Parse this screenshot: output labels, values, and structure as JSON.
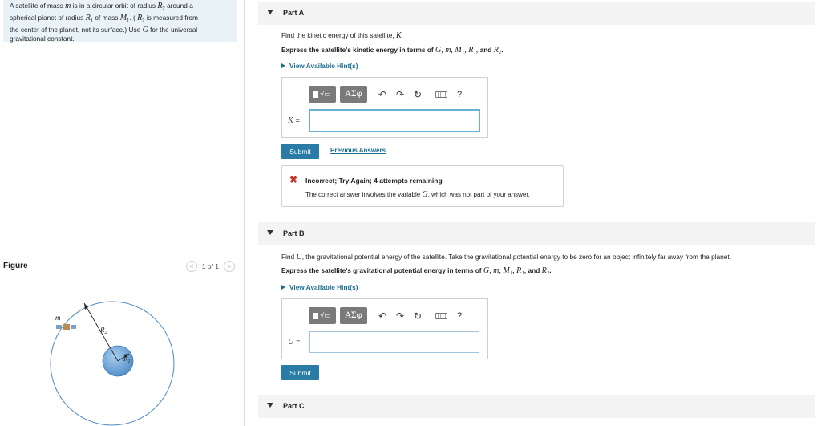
{
  "problem": {
    "line1_a": "A satellite of mass ",
    "line1_m": "m",
    "line1_b": " is in a circular orbit of radius ",
    "line1_R2": "R",
    "line1_R2_sub": "2",
    "line1_c": " around a",
    "line2_a": "spherical planet of radius ",
    "line2_R1": "R",
    "line2_R1_sub": "1",
    "line2_b": " of mass ",
    "line2_M1": "M",
    "line2_M1_sub": "1",
    "line2_c": ". ( ",
    "line2_R2": "R",
    "line2_R2_sub": "2",
    "line2_d": " is measured from",
    "line3": "the center of the planet, not its surface.) Use ",
    "line3_G": "G",
    "line3_b": " for the universal",
    "line4": "gravitational constant."
  },
  "figure": {
    "label": "Figure",
    "pager_text": "1 of 1",
    "prev_glyph": "<",
    "next_glyph": ">",
    "label_m": "m",
    "label_R2": "R",
    "label_R2_sub": "2",
    "label_R1": "R",
    "label_R1_sub": "1"
  },
  "toolbar": {
    "greek_label": "ΑΣφ",
    "undo_glyph": "↶",
    "redo_glyph": "↷",
    "reset_glyph": "↻",
    "help_glyph": "?"
  },
  "partA": {
    "title": "Part A",
    "question_a": "Find the kinetic energy of this satellite, ",
    "question_K": "K",
    "question_b": ".",
    "instruction": "Express the satellite's kinetic energy in terms of ",
    "vars": "G, m, M₁, R₁,",
    "instruction_and": " and ",
    "var_last": "R₂",
    "instruction_end": ".",
    "hint_label": "View Available Hint(s)",
    "var_label": "K",
    "eq": "=",
    "input_value": "",
    "submit_label": "Submit",
    "previous_answers_label": "Previous Answers",
    "feedback_icon": "✖",
    "feedback_title": "Incorrect; Try Again; 4 attempts remaining",
    "feedback_msg_a": "The correct answer involves the variable ",
    "feedback_msg_G": "G",
    "feedback_msg_b": ", which was not part of your answer."
  },
  "partB": {
    "title": "Part B",
    "question_a": "Find ",
    "question_U": "U",
    "question_b": ", the gravitational potential energy of the satellite. Take the gravitational potential energy to be zero for an object infinitely far away from the planet.",
    "instruction": "Express the satellite's gravitational potential energy in terms of ",
    "vars": "G, m, M₁, R₁,",
    "instruction_and": " and ",
    "var_last": "R₂",
    "instruction_end": ".",
    "hint_label": "View Available Hint(s)",
    "var_label": "U",
    "eq": "=",
    "input_value": "",
    "submit_label": "Submit"
  },
  "partC": {
    "title": "Part C"
  },
  "colors": {
    "accent": "#2a7ca6",
    "link": "#1a6b8f",
    "error": "#c0392b",
    "problem_bg": "#e9f3f7",
    "planet": "#5f9bd3",
    "orbit": "#4a88c8"
  }
}
